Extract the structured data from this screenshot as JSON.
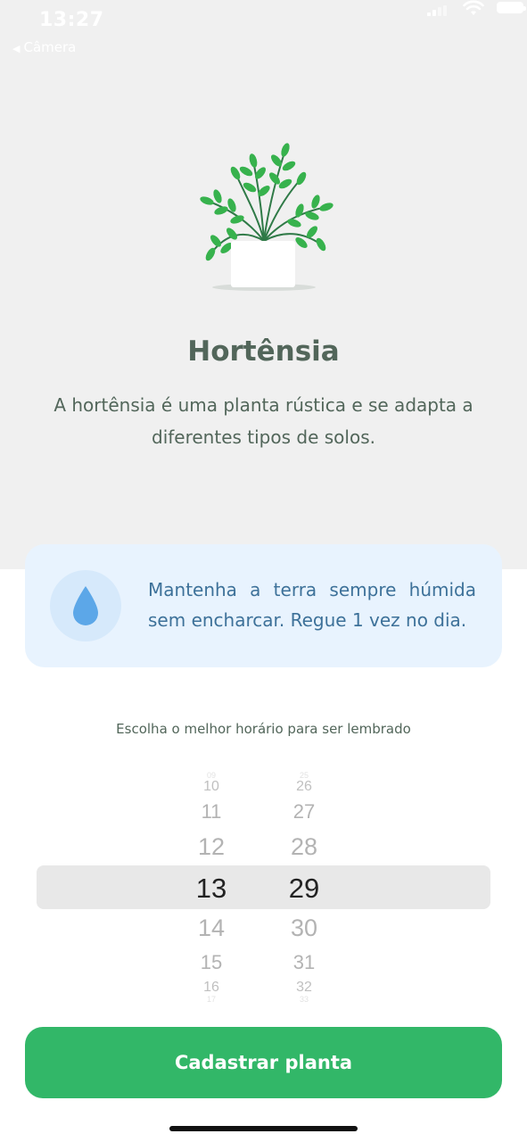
{
  "status_bar": {
    "time": "13:27",
    "back_app": "Câmera",
    "icons": [
      "signal-icon",
      "wifi-icon",
      "battery-icon"
    ]
  },
  "plant": {
    "name": "Hortênsia",
    "about": "A hortênsia é uma planta rústica e se adapta a diferentes tipos de solos.",
    "illustration": "potted-plant-icon"
  },
  "tip": {
    "icon": "water-drop-icon",
    "text": "Mantenha a terra sempre húmida sem encharcar. Regue 1 vez no dia."
  },
  "reminder": {
    "label": "Escolha o melhor horário para ser lembrado"
  },
  "time_picker": {
    "hours": [
      "09",
      "10",
      "11",
      "12",
      "13",
      "14",
      "15",
      "16",
      "17"
    ],
    "minutes": [
      "25",
      "26",
      "27",
      "28",
      "29",
      "30",
      "31",
      "32",
      "33"
    ],
    "selected_hour": "13",
    "selected_minute": "29"
  },
  "actions": {
    "submit_label": "Cadastrar planta"
  },
  "colors": {
    "primary_green": "#32b768",
    "heading_text": "#52665a",
    "tip_background": "#e8f3fe",
    "tip_text": "#3d7199",
    "water_blue": "#5ca7e8"
  }
}
